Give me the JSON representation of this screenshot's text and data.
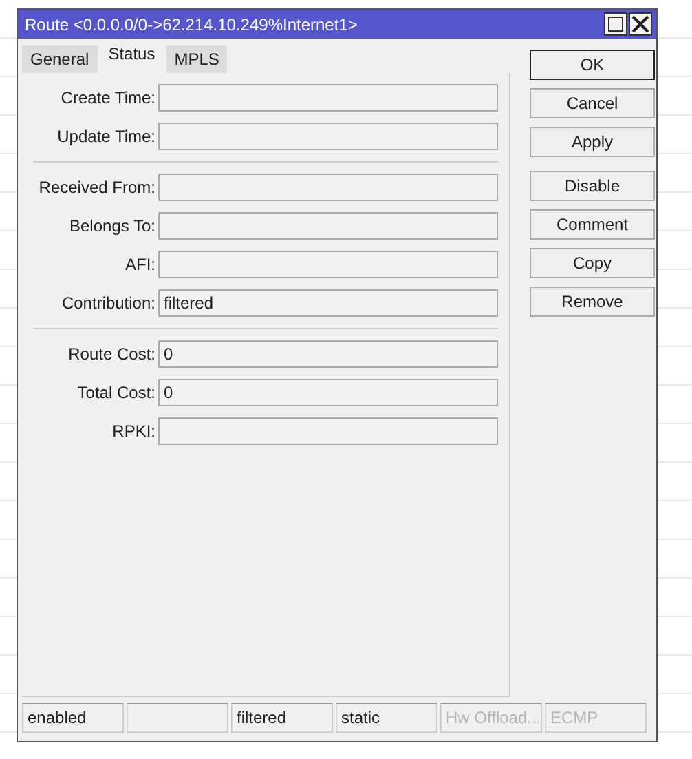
{
  "window": {
    "title": "Route <0.0.0.0/0->62.214.10.249%Internet1>"
  },
  "tabs": [
    {
      "label": "General",
      "selected": false
    },
    {
      "label": "Status",
      "selected": true
    },
    {
      "label": "MPLS",
      "selected": false
    }
  ],
  "sections": [
    {
      "fields": [
        {
          "label": "Create Time:"
        },
        {
          "label": "Update Time:"
        }
      ]
    },
    {
      "fields": [
        {
          "label": "Received From:"
        },
        {
          "label": "Belongs To:"
        },
        {
          "label": "AFI:"
        },
        {
          "label": "Contribution:",
          "value": "filtered"
        }
      ]
    },
    {
      "fields": [
        {
          "label": "Route Cost:",
          "value": "0"
        },
        {
          "label": "Total Cost:",
          "value": "0"
        },
        {
          "label": "RPKI:"
        }
      ]
    }
  ],
  "button_groups": [
    [
      {
        "label": "OK",
        "default": true
      },
      {
        "label": "Cancel",
        "default": false
      },
      {
        "label": "Apply",
        "default": false
      }
    ],
    [
      {
        "label": "Disable",
        "default": false
      },
      {
        "label": "Comment",
        "default": false
      },
      {
        "label": "Copy",
        "default": false
      },
      {
        "label": "Remove",
        "default": false
      }
    ]
  ],
  "status_bar": [
    {
      "kind": "text",
      "text": "enabled",
      "disabled": false
    },
    {
      "kind": "blank"
    },
    {
      "kind": "text",
      "text": "filtered",
      "disabled": false
    },
    {
      "kind": "text",
      "text": "static",
      "disabled": false
    },
    {
      "kind": "text",
      "text": "Hw Offload...",
      "disabled": true
    },
    {
      "kind": "text",
      "text": "ECMP",
      "disabled": true
    }
  ]
}
